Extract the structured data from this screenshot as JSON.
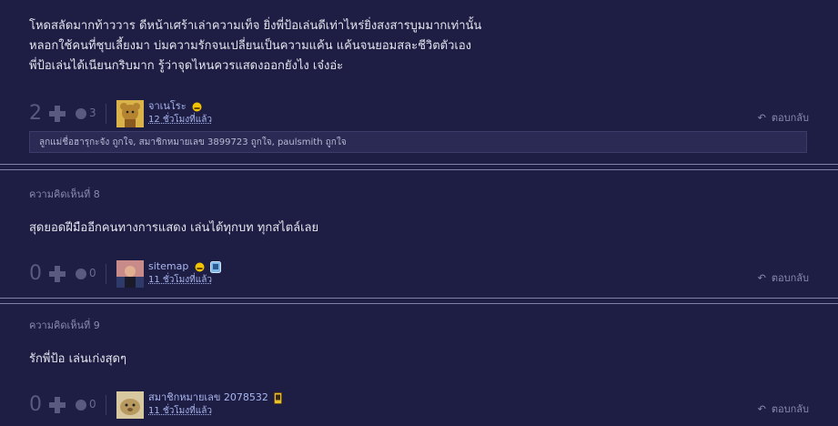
{
  "comments": [
    {
      "body": "โหดสลัดมากท้าววาร ดีหน้าเศร้าเล่าความเท็จ ยิ่งพี่ป้อเล่นดีเท่าไหร่ยิ่งสงสารบูมมากเท่านั้น\nหลอกใช้คนที่ชุบเลี้ยงมา บ่มความรักจนเปลี่ยนเป็นความแค้น แค้นจนยอมสละชีวิตตัวเอง\nพี่ป้อเล่นได้เนียนกริบมาก รู้ว่าจุดไหนควรแสดงออกยังไง เจ๋งอ่ะ",
      "score": "2",
      "minus": "3",
      "username": "จาเนโระ",
      "time": "12 ชั่วโมงที่แล้ว",
      "reply": "ตอบกลับ",
      "likes": "ลูกแม่ชื่อฮารุกะจัง ถูกใจ, สมาชิกหมายเลข 3899723 ถูกใจ, paulsmith ถูกใจ"
    },
    {
      "header": "ความคิดเห็นที่ 8",
      "body": "สุดยอดฝีมืออีกคนทางการแสดง เล่นได้ทุกบท ทุกสไตล์เลย",
      "score": "0",
      "minus": "0",
      "username": "sitemap",
      "time": "11 ชั่วโมงที่แล้ว",
      "reply": "ตอบกลับ"
    },
    {
      "header": "ความคิดเห็นที่ 9",
      "body": "รักพี่ป้อ เล่นเก่งสุดๆ",
      "score": "0",
      "minus": "0",
      "username": "สมาชิกหมายเลข 2078532",
      "time": "11 ชั่วโมงที่แล้ว",
      "reply": "ตอบกลับ"
    }
  ],
  "colors": {
    "background": "#1e1e44",
    "link": "#a9b6ee",
    "muted": "#5a5a80"
  },
  "icons": [
    "plus-icon",
    "minus-icon",
    "reply-icon",
    "emoji-badge-icon",
    "mobile-badge-icon"
  ]
}
